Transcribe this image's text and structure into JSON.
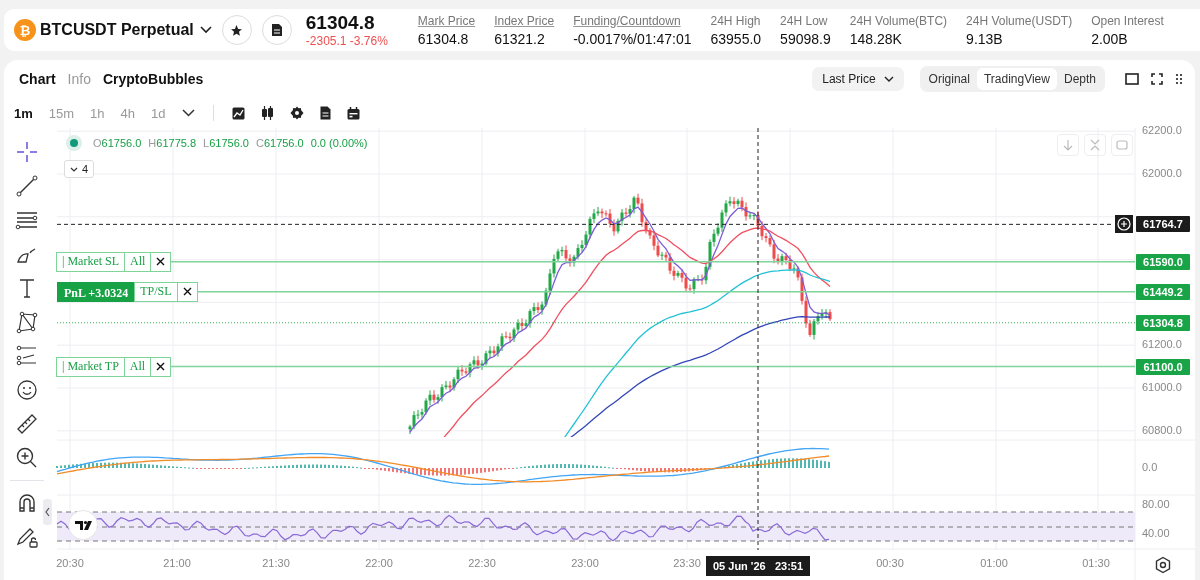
{
  "header": {
    "symbol_glyph": "₿",
    "symbol": "BTCUSDT Perpetual",
    "last_price": "61304.8",
    "change": "-2305.1 -3.76%",
    "stats": [
      {
        "label": "Mark Price",
        "value": "61304.8",
        "underlined": true
      },
      {
        "label": "Index Price",
        "value": "61321.2",
        "underlined": true
      },
      {
        "label": "Funding/Countdown",
        "value": "-0.0017%/01:47:01",
        "underlined": true
      },
      {
        "label": "24H High",
        "value": "63955.0",
        "underlined": false
      },
      {
        "label": "24H Low",
        "value": "59098.9",
        "underlined": false
      },
      {
        "label": "24H Volume(BTC)",
        "value": "148.28K",
        "underlined": false
      },
      {
        "label": "24H Volume(USDT)",
        "value": "9.13B",
        "underlined": false
      },
      {
        "label": "Open Interest",
        "value": "2.00B",
        "underlined": false
      }
    ]
  },
  "chart_panel": {
    "tabs": [
      {
        "label": "Chart",
        "kind": "tab",
        "selected": true
      },
      {
        "label": "Info",
        "kind": "tab",
        "selected": false
      },
      {
        "label": "CryptoBubbles",
        "kind": "link"
      }
    ],
    "price_source": "Last Price",
    "views": [
      {
        "label": "Original",
        "selected": false
      },
      {
        "label": "TradingView",
        "selected": true
      },
      {
        "label": "Depth",
        "selected": false
      }
    ],
    "intervals": [
      {
        "label": "1m",
        "selected": true
      },
      {
        "label": "15m",
        "selected": false
      },
      {
        "label": "1h",
        "selected": false
      },
      {
        "label": "4h",
        "selected": false
      },
      {
        "label": "1d",
        "selected": false
      }
    ],
    "legend": {
      "values": [
        {
          "letter": "O",
          "value": "61756.0"
        },
        {
          "letter": "H",
          "value": "61775.8"
        },
        {
          "letter": "L",
          "value": "61756.0"
        },
        {
          "letter": "C",
          "value": "61756.0"
        }
      ],
      "change": "0.0 (0.00%)",
      "collapsed_count": "4"
    },
    "price_axis": [
      "62200.0",
      "62000.0",
      "61200.0",
      "61000.0",
      "60800.0"
    ],
    "order_lines": [
      {
        "kind": "stop_loss",
        "tag": "| Market SL",
        "qty": "All",
        "price": "61590.0"
      },
      {
        "kind": "position",
        "pnl": "PnL +3.0324",
        "tag": "TP/SL",
        "price": "61449.2"
      },
      {
        "kind": "take_profit",
        "tag": "| Market TP",
        "qty": "All",
        "price": "61100.0"
      }
    ],
    "last_price_line": {
      "price": "61304.8"
    },
    "crosshair": {
      "price": "61764.7",
      "time": "05 Jun '26   23:51"
    },
    "macd_axis": [
      "0.0"
    ],
    "rsi_axis": [
      "80.00",
      "40.00"
    ],
    "time_axis": [
      "20:30",
      "21:00",
      "21:30",
      "22:00",
      "22:30",
      "23:00",
      "23:30",
      "00:30",
      "01:00",
      "01:30"
    ]
  }
}
